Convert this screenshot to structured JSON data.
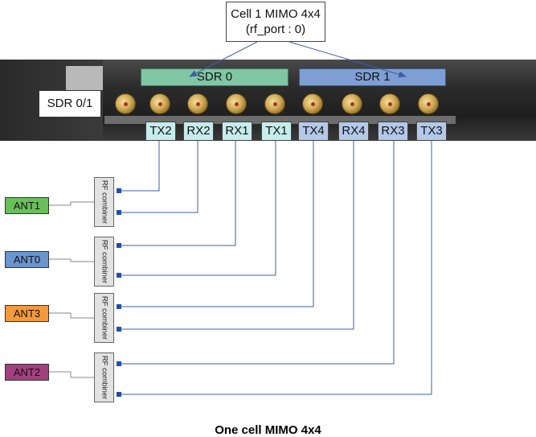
{
  "title_box": {
    "line1": "Cell 1 MIMO 4x4",
    "line2": "(rf_port : 0)"
  },
  "device_label": "SDR 0/1",
  "sdr0": {
    "label": "SDR 0",
    "color": "#7fc7a4"
  },
  "sdr1": {
    "label": "SDR 1",
    "color": "#7e9fd4"
  },
  "ports": [
    "TX2",
    "RX2",
    "RX1",
    "TX1",
    "TX4",
    "RX4",
    "RX3",
    "TX3"
  ],
  "combiner_label": "RF combiner",
  "antennas": [
    {
      "label": "ANT1",
      "color": "#6abf5a"
    },
    {
      "label": "ANT0",
      "color": "#6a95cf"
    },
    {
      "label": "ANT3",
      "color": "#f59a3c"
    },
    {
      "label": "ANT2",
      "color": "#a3407f"
    }
  ],
  "caption": "One cell MIMO 4x4",
  "line_color": "#3d5fa8"
}
